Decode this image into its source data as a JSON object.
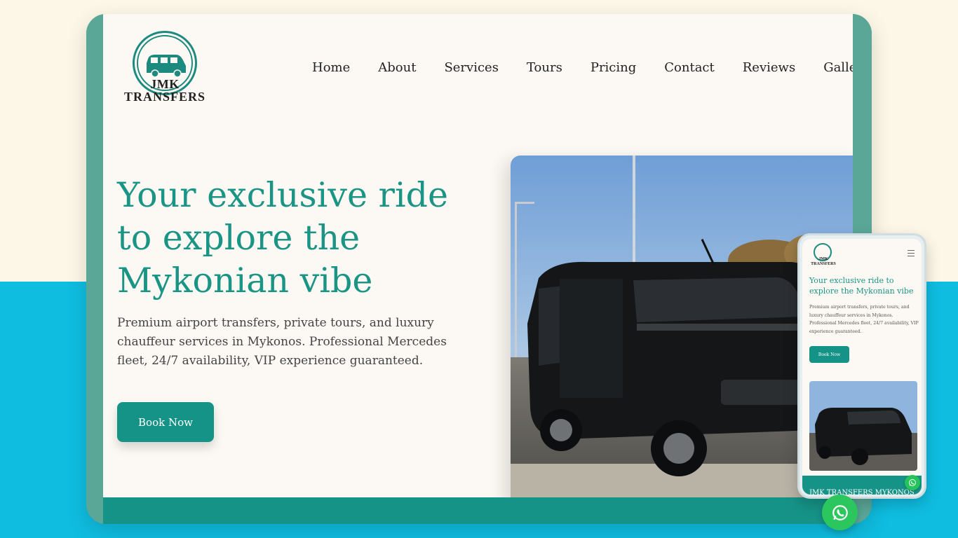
{
  "brand": {
    "line1": "JMK",
    "line2": "TRANSFERS"
  },
  "nav": [
    {
      "label": "Home"
    },
    {
      "label": "About"
    },
    {
      "label": "Services"
    },
    {
      "label": "Tours"
    },
    {
      "label": "Pricing"
    },
    {
      "label": "Contact"
    },
    {
      "label": "Reviews"
    },
    {
      "label": "Gallery"
    }
  ],
  "hero": {
    "title_1": "Your exclusive ride",
    "title_2": "to explore the",
    "title_3": "Mykonian vibe",
    "subtitle": "Premium airport transfers, private tours, and luxury chauffeur services in Mykonos. Professional Mercedes fleet, 24/7 availability, VIP experience guaranteed.",
    "cta": "Book Now"
  },
  "mobile": {
    "title": "Your exclusive ride to explore the Mykonian vibe",
    "subtitle": "Premium airport transfers, private tours, and luxury chauffeur services in Mykonos. Professional Mercedes fleet, 24/7 availability, VIP experience guaranteed.",
    "cta": "Book Now",
    "footer": "JMK TRANSFERS MYKONOS"
  },
  "icons": {
    "menu": "hamburger-menu-icon",
    "whatsapp": "whatsapp-icon"
  },
  "colors": {
    "accent": "#169387",
    "title": "#1a9484",
    "whatsapp": "#2bc65e",
    "background_lower": "#0fbde0"
  }
}
